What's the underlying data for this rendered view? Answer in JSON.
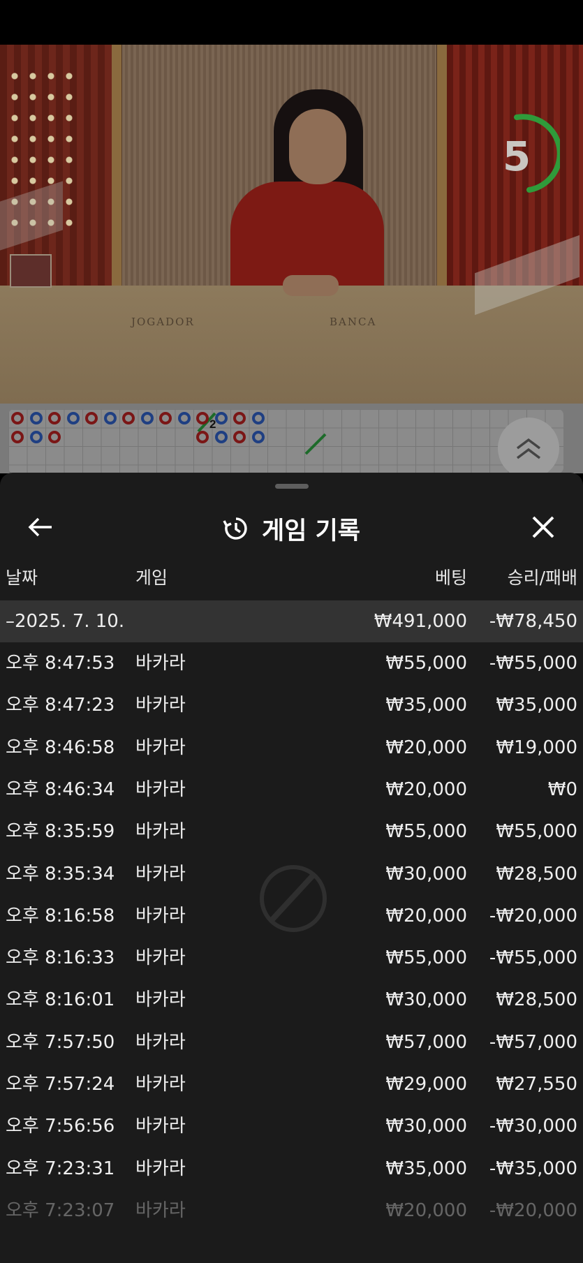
{
  "timer": {
    "count": "5",
    "color": "#2f9b3a"
  },
  "roadmap": {
    "marker_number": "2",
    "beads": [
      {
        "row": 0,
        "col": 0,
        "c": "r"
      },
      {
        "row": 0,
        "col": 1,
        "c": "b"
      },
      {
        "row": 0,
        "col": 2,
        "c": "r"
      },
      {
        "row": 0,
        "col": 3,
        "c": "b"
      },
      {
        "row": 0,
        "col": 4,
        "c": "r"
      },
      {
        "row": 0,
        "col": 5,
        "c": "b"
      },
      {
        "row": 0,
        "col": 6,
        "c": "r"
      },
      {
        "row": 0,
        "col": 7,
        "c": "b"
      },
      {
        "row": 0,
        "col": 8,
        "c": "r"
      },
      {
        "row": 0,
        "col": 9,
        "c": "b"
      },
      {
        "row": 0,
        "col": 10,
        "c": "r"
      },
      {
        "row": 0,
        "col": 11,
        "c": "b"
      },
      {
        "row": 0,
        "col": 12,
        "c": "r"
      },
      {
        "row": 0,
        "col": 13,
        "c": "b"
      },
      {
        "row": 1,
        "col": 0,
        "c": "r"
      },
      {
        "row": 1,
        "col": 1,
        "c": "b"
      },
      {
        "row": 1,
        "col": 2,
        "c": "r"
      },
      {
        "row": 1,
        "col": 10,
        "c": "r"
      },
      {
        "row": 1,
        "col": 11,
        "c": "b"
      },
      {
        "row": 1,
        "col": 12,
        "c": "r"
      },
      {
        "row": 1,
        "col": 13,
        "c": "b"
      }
    ]
  },
  "sheet": {
    "title": "게임 기록",
    "columns": {
      "date": "날짜",
      "game": "게임",
      "bet": "베팅",
      "winloss": "승리/패배"
    },
    "date_group": {
      "label": "–2025. 7. 10.",
      "bet": "₩491,000",
      "winloss": "-₩78,450"
    },
    "rows": [
      {
        "time": "오후 8:47:53",
        "game": "바카라",
        "bet": "₩55,000",
        "winloss": "-₩55,000"
      },
      {
        "time": "오후 8:47:23",
        "game": "바카라",
        "bet": "₩35,000",
        "winloss": "₩35,000"
      },
      {
        "time": "오후 8:46:58",
        "game": "바카라",
        "bet": "₩20,000",
        "winloss": "₩19,000"
      },
      {
        "time": "오후 8:46:34",
        "game": "바카라",
        "bet": "₩20,000",
        "winloss": "₩0"
      },
      {
        "time": "오후 8:35:59",
        "game": "바카라",
        "bet": "₩55,000",
        "winloss": "₩55,000"
      },
      {
        "time": "오후 8:35:34",
        "game": "바카라",
        "bet": "₩30,000",
        "winloss": "₩28,500"
      },
      {
        "time": "오후 8:16:58",
        "game": "바카라",
        "bet": "₩20,000",
        "winloss": "-₩20,000"
      },
      {
        "time": "오후 8:16:33",
        "game": "바카라",
        "bet": "₩55,000",
        "winloss": "-₩55,000"
      },
      {
        "time": "오후 8:16:01",
        "game": "바카라",
        "bet": "₩30,000",
        "winloss": "₩28,500"
      },
      {
        "time": "오후 7:57:50",
        "game": "바카라",
        "bet": "₩57,000",
        "winloss": "-₩57,000"
      },
      {
        "time": "오후 7:57:24",
        "game": "바카라",
        "bet": "₩29,000",
        "winloss": "₩27,550"
      },
      {
        "time": "오후 7:56:56",
        "game": "바카라",
        "bet": "₩30,000",
        "winloss": "-₩30,000"
      },
      {
        "time": "오후 7:23:31",
        "game": "바카라",
        "bet": "₩35,000",
        "winloss": "-₩35,000"
      },
      {
        "time": "오후 7:23:07",
        "game": "바카라",
        "bet": "₩20,000",
        "winloss": "-₩20,000"
      }
    ]
  },
  "table_labels": {
    "player": "JOGADOR",
    "banker": "BANCA"
  }
}
